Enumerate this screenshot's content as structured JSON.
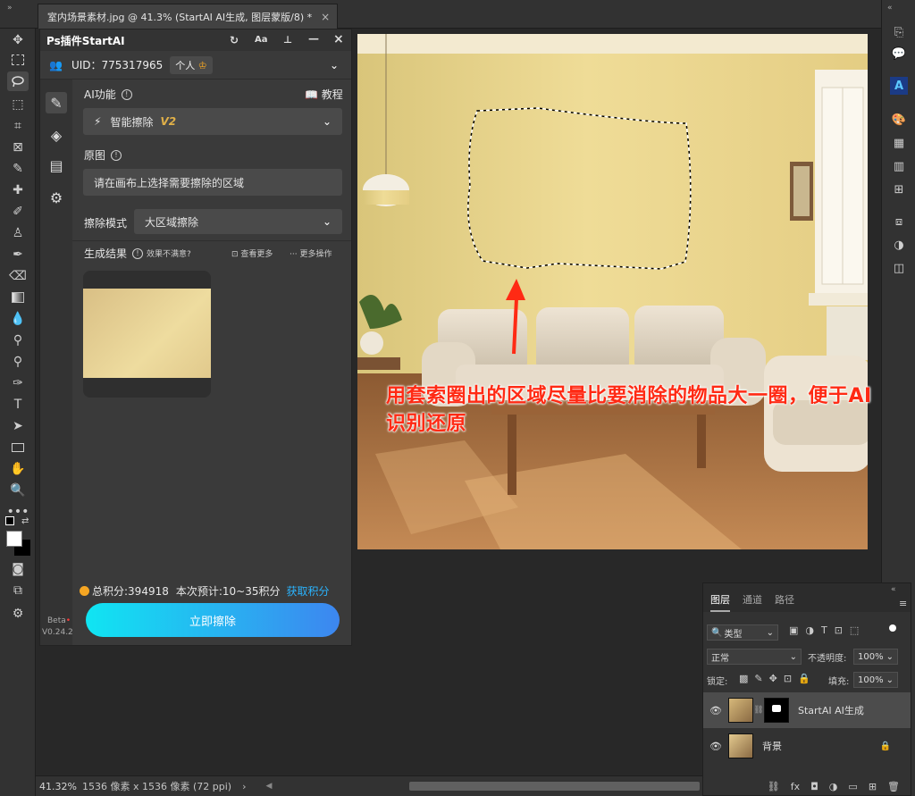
{
  "document_tab": {
    "title": "室内场景素材.jpg @ 41.3% (StartAI AI生成, 图层蒙版/8) *",
    "close": "×"
  },
  "plugin": {
    "title": "Ps插件StartAI",
    "uid_label": "UID：775317965",
    "account_type": "个人",
    "ai_function_label": "AI功能",
    "tutorial_label": "教程",
    "ai_function_value": "智能擦除",
    "ai_function_version": "V2",
    "original_label": "原图",
    "original_placeholder": "请在画布上选择需要擦除的区域",
    "erase_mode_label": "擦除模式",
    "erase_mode_value": "大区域擦除",
    "result_label": "生成结果",
    "unsatisfied_label": "效果不满意?",
    "view_more_label": "查看更多",
    "more_actions_label": "更多操作",
    "credits_text": "总积分:394918",
    "estimate_text": "本次预计:10~35积分",
    "get_credits_label": "获取积分",
    "erase_button_label": "立即擦除",
    "beta_label": "Beta",
    "version_label": "V0.24.2"
  },
  "canvas": {
    "callout_text": "用套索圈出的区域尽量比要消除的物品大一圈，便于AI识别还原"
  },
  "status": {
    "zoom": "41.32%",
    "doc_info": "1536 像素 x 1536 像素 (72 ppi)",
    "arrow": "›"
  },
  "layers_panel": {
    "tabs": [
      "图层",
      "通道",
      "路径"
    ],
    "filter_kind": "类型",
    "blend_mode": "正常",
    "opacity_label": "不透明度:",
    "opacity_value": "100%",
    "lock_label": "锁定:",
    "fill_label": "填充:",
    "fill_value": "100%",
    "layers": [
      {
        "name": "StartAI AI生成"
      },
      {
        "name": "背景"
      }
    ]
  },
  "colors": {
    "accent": "#2ab4ff",
    "callout": "#ff2a14",
    "button_start": "#10e5f2",
    "button_end": "#3d86f0",
    "credit_dot": "#f5a623"
  }
}
